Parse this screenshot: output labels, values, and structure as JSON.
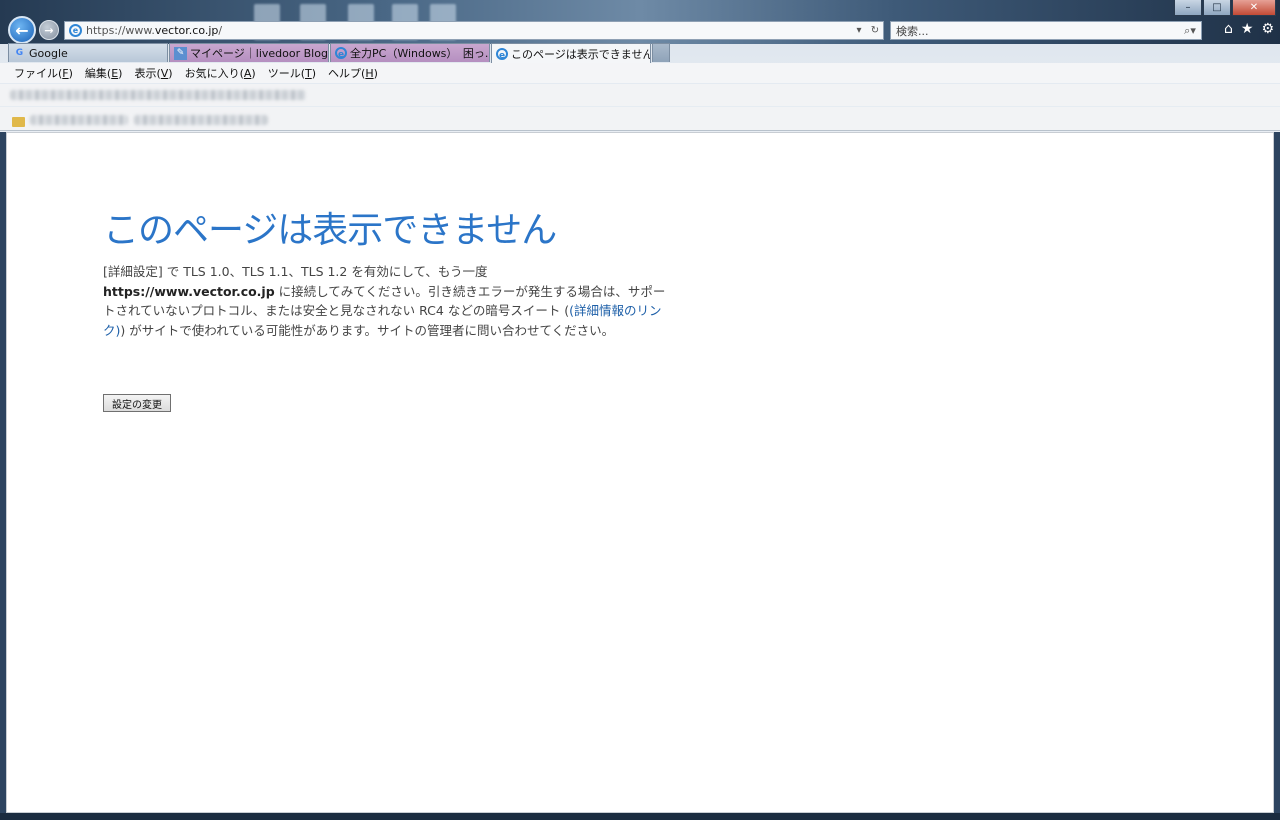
{
  "window": {
    "controls": [
      "–",
      "□",
      "✕"
    ]
  },
  "address_bar": {
    "url_prefix": "https://www.",
    "url_domain": "vector.co.jp",
    "url_suffix": "/",
    "dropdown": "▾",
    "refresh": "↻"
  },
  "search_bar": {
    "placeholder": "検索...",
    "icon": "⌕▾"
  },
  "toolbar_icons": {
    "home": "⌂",
    "favorites": "★",
    "settings": "⚙"
  },
  "tabs": [
    {
      "label": "Google",
      "favicon": "G"
    },
    {
      "label": "マイページ｜livedoor Blog",
      "favicon": "✎"
    },
    {
      "label": "全力PC（Windows）　困っ...",
      "favicon": "e"
    },
    {
      "label": "このページは表示できません",
      "favicon": "e",
      "close": "✕"
    }
  ],
  "menu": [
    {
      "label": "ファイル(",
      "key": "F",
      "end": ")"
    },
    {
      "label": "編集(",
      "key": "E",
      "end": ")"
    },
    {
      "label": "表示(",
      "key": "V",
      "end": ")"
    },
    {
      "label": "お気に入り(",
      "key": "A",
      "end": ")"
    },
    {
      "label": "ツール(",
      "key": "T",
      "end": ")"
    },
    {
      "label": "ヘルプ(",
      "key": "H",
      "end": ")"
    }
  ],
  "error": {
    "title": "このページは表示できません",
    "p1": "[詳細設定] で TLS 1.0、TLS 1.1、TLS 1.2 を有効にして、もう一度",
    "host": "https://www.vector.co.jp",
    "p2": " に接続してみてください。引き続きエラーが発生する場合は、サポートされていないプロトコル、または安全と見なされない RC4 などの暗号スイート (",
    "link": "(詳細情報のリンク)",
    "p3": ") がサイトで使われている可能性があります。サイトの管理者に問い合わせてください。",
    "button": "設定の変更"
  }
}
